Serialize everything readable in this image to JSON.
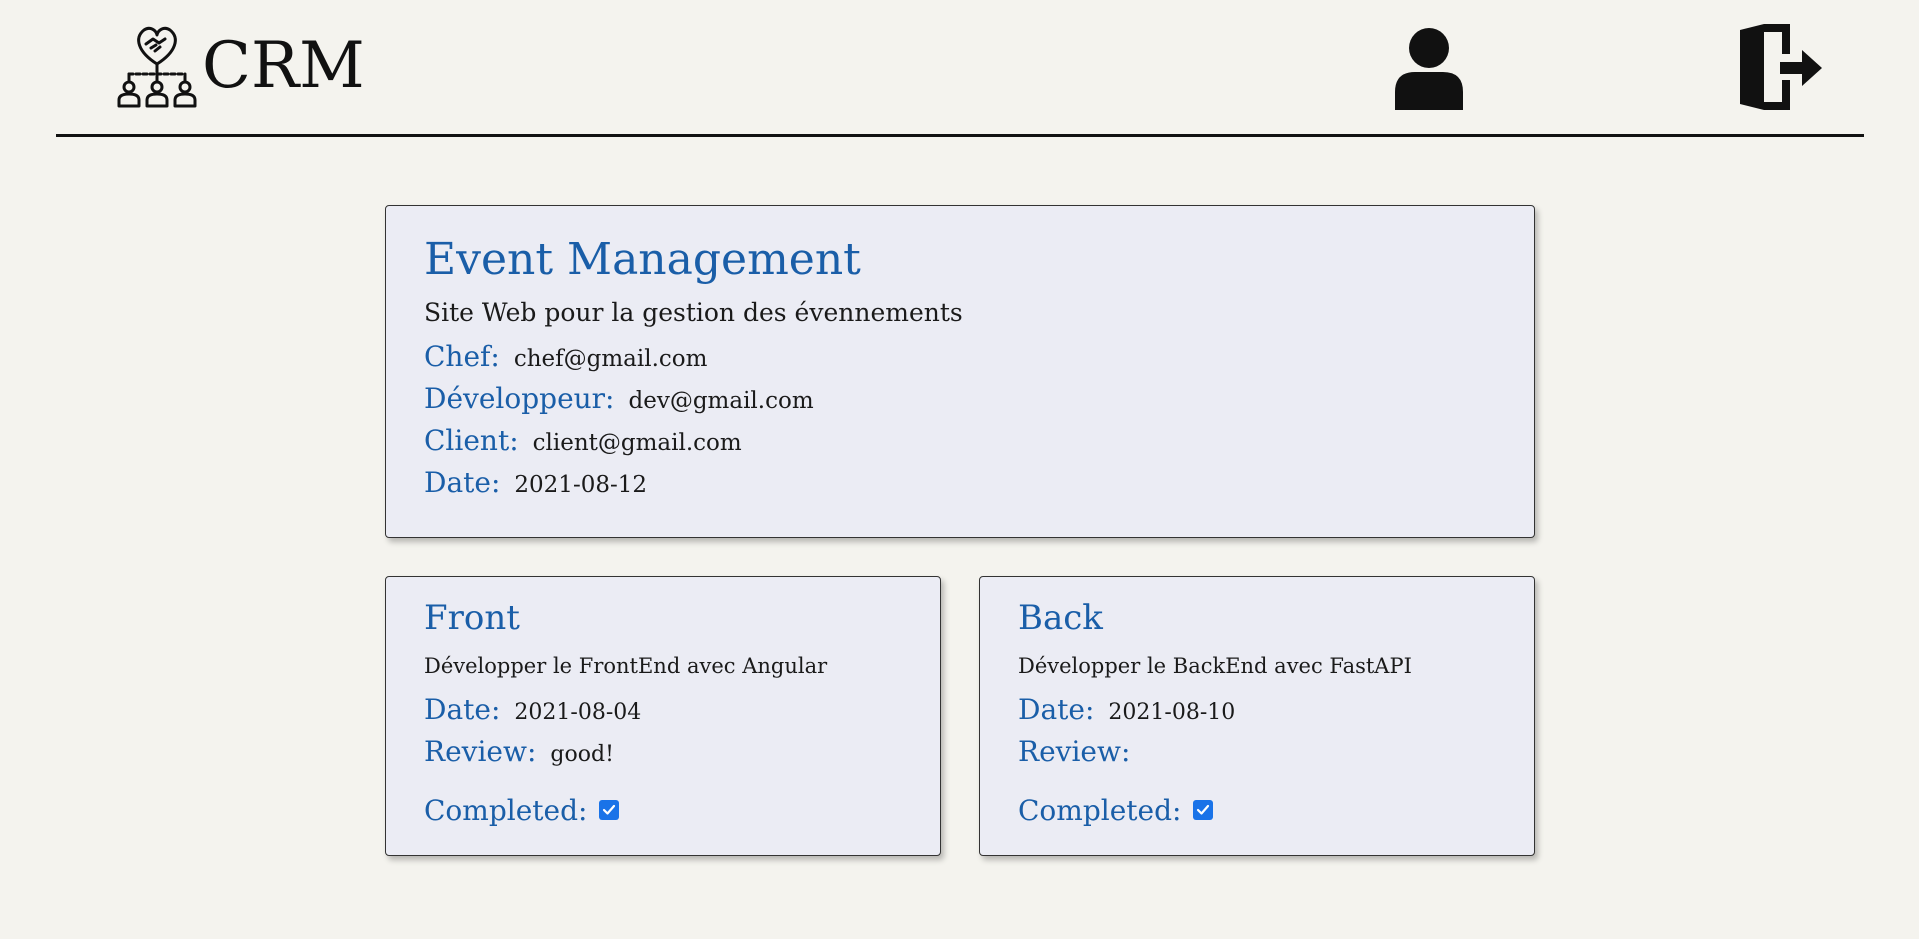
{
  "header": {
    "app_name": "CRM",
    "logo_icon": "crm-team-handshake-icon",
    "user_icon": "user-icon",
    "logout_icon": "logout-icon"
  },
  "project": {
    "title": "Event Management",
    "description": "Site Web pour la gestion des évennements",
    "fields": [
      {
        "label": "Chef:",
        "value": "chef@gmail.com"
      },
      {
        "label": "Développeur:",
        "value": "dev@gmail.com"
      },
      {
        "label": "Client:",
        "value": "client@gmail.com"
      },
      {
        "label": "Date:",
        "value": "2021-08-12"
      }
    ]
  },
  "tasks": [
    {
      "title": "Front",
      "description": "Développer le FrontEnd avec Angular",
      "date_label": "Date:",
      "date": "2021-08-04",
      "review_label": "Review:",
      "review": "good!",
      "completed_label": "Completed:",
      "completed": true
    },
    {
      "title": "Back",
      "description": "Développer le BackEnd avec FastAPI",
      "date_label": "Date:",
      "date": "2021-08-10",
      "review_label": "Review:",
      "review": "",
      "completed_label": "Completed:",
      "completed": true
    }
  ],
  "colors": {
    "accent": "#1a5ea8",
    "background": "#f4f3ee",
    "card": "#ebecf4",
    "checkbox": "#1a73e8"
  }
}
